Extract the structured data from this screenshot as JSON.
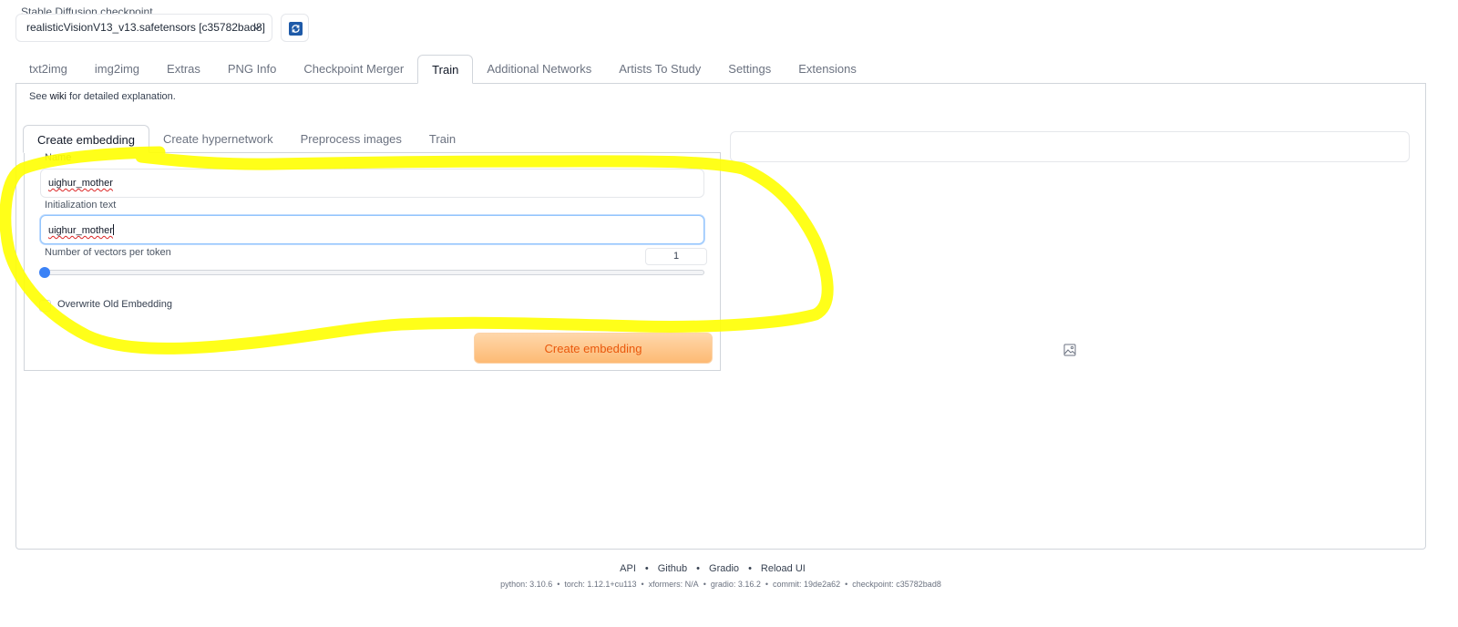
{
  "checkpoint": {
    "label": "Stable Diffusion checkpoint",
    "value": "realisticVisionV13_v13.safetensors [c35782bad8]"
  },
  "main_tabs": [
    "txt2img",
    "img2img",
    "Extras",
    "PNG Info",
    "Checkpoint Merger",
    "Train",
    "Additional Networks",
    "Artists To Study",
    "Settings",
    "Extensions"
  ],
  "active_main_tab": "Train",
  "wiki": {
    "prefix": "See ",
    "link": "wiki",
    "suffix": " for detailed explanation."
  },
  "sub_tabs": [
    "Create embedding",
    "Create hypernetwork",
    "Preprocess images",
    "Train"
  ],
  "active_sub_tab": "Create embedding",
  "form": {
    "name_label": "Name",
    "name_value": "uighur_mother",
    "init_label": "Initialization text",
    "init_value": "uighur_mother",
    "vectors_label": "Number of vectors per token",
    "vectors_value": "1",
    "overwrite_label": "Overwrite Old Embedding",
    "overwrite_checked": false,
    "create_button": "Create embedding"
  },
  "footer": {
    "links": [
      "API",
      "Github",
      "Gradio",
      "Reload UI"
    ],
    "info": [
      "python: 3.10.6",
      "torch: 1.12.1+cu113",
      "xformers: N/A",
      "gradio: 3.16.2",
      "commit: 19de2a62",
      "checkpoint: c35782bad8"
    ]
  },
  "colors": {
    "accent_orange": "#ea580c",
    "slider_blue": "#3b82f6",
    "highlight_yellow": "#ffff00"
  }
}
